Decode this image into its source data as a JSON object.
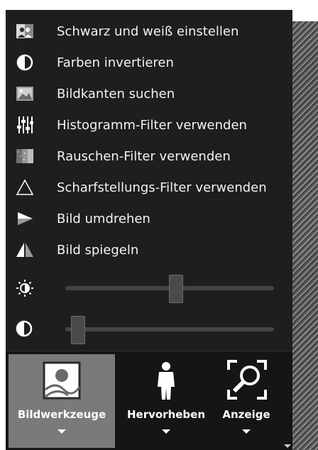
{
  "menu": {
    "items": [
      {
        "label": "Schwarz und weiß einstellen",
        "icon": "black-white-icon"
      },
      {
        "label": "Farben invertieren",
        "icon": "invert-colors-icon"
      },
      {
        "label": "Bildkanten suchen",
        "icon": "edge-detect-icon"
      },
      {
        "label": "Histogramm-Filter verwenden",
        "icon": "histogram-filter-icon"
      },
      {
        "label": "Rauschen-Filter verwenden",
        "icon": "noise-filter-icon"
      },
      {
        "label": "Scharfstellungs-Filter verwenden",
        "icon": "sharpen-filter-icon"
      },
      {
        "label": "Bild umdrehen",
        "icon": "flip-icon"
      },
      {
        "label": "Bild spiegeln",
        "icon": "mirror-icon"
      }
    ],
    "sliders": [
      {
        "name": "brightness",
        "icon": "brightness-icon",
        "value": 0.53
      },
      {
        "name": "contrast",
        "icon": "contrast-icon",
        "value": 0.03
      }
    ]
  },
  "toolbar": {
    "buttons": [
      {
        "label": "Bildwerkzeuge",
        "icon": "image-tools-icon",
        "active": true
      },
      {
        "label": "Hervorheben",
        "icon": "highlight-person-icon",
        "active": false
      },
      {
        "label": "Anzeige",
        "icon": "zoom-view-icon",
        "active": false
      }
    ]
  },
  "colors": {
    "menu_bg": "#1e1e1e",
    "toolbar_bg": "#151515",
    "active_bg": "#7a7a7a",
    "text": "#f2f2f2"
  }
}
